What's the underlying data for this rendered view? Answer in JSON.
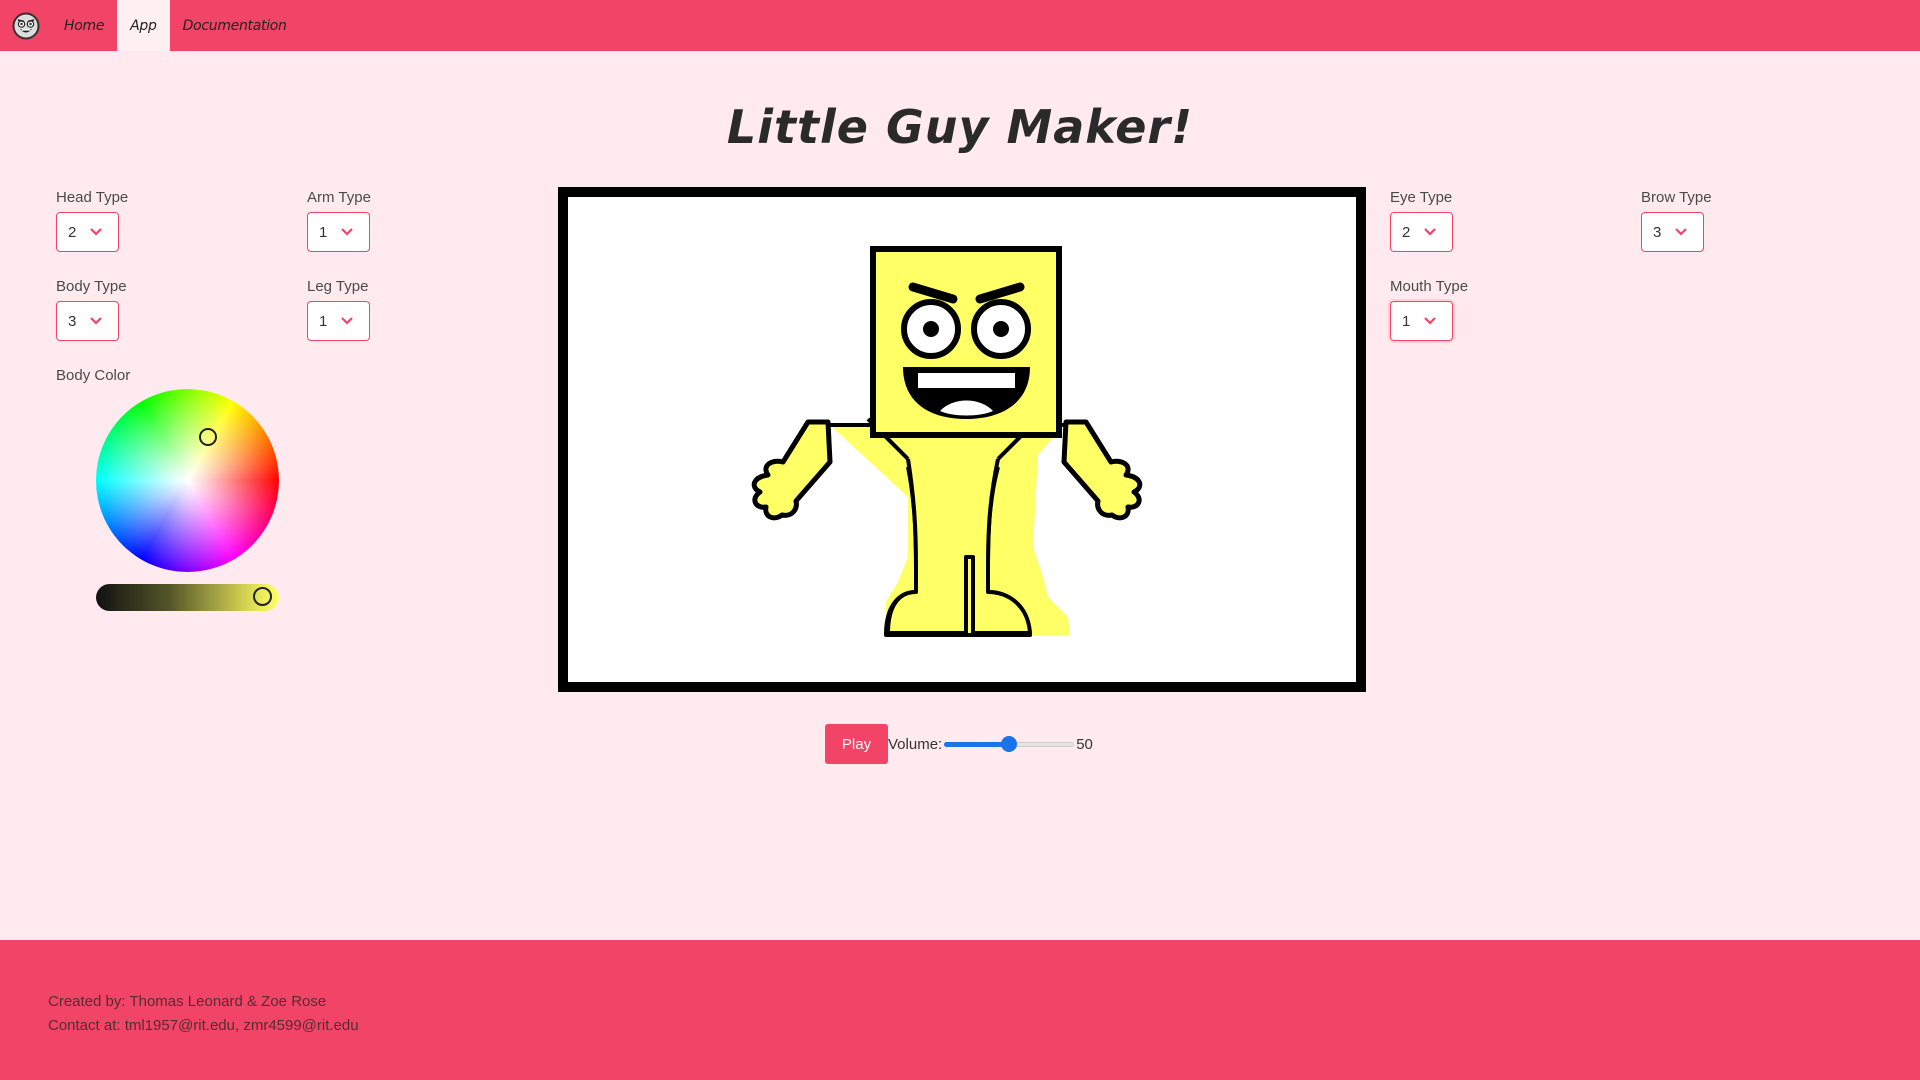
{
  "nav": {
    "items": [
      {
        "label": "Home",
        "active": false
      },
      {
        "label": "App",
        "active": true
      },
      {
        "label": "Documentation",
        "active": false
      }
    ]
  },
  "page": {
    "title": "Little Guy Maker!"
  },
  "controls": {
    "head_type": {
      "label": "Head Type",
      "value": "2"
    },
    "arm_type": {
      "label": "Arm Type",
      "value": "1"
    },
    "body_type": {
      "label": "Body Type",
      "value": "3"
    },
    "leg_type": {
      "label": "Leg Type",
      "value": "1"
    },
    "eye_type": {
      "label": "Eye Type",
      "value": "2"
    },
    "brow_type": {
      "label": "Brow Type",
      "value": "3"
    },
    "mouth_type": {
      "label": "Mouth Type",
      "value": "1"
    },
    "body_color": {
      "label": "Body Color",
      "value": "#ffff66"
    }
  },
  "player": {
    "play_label": "Play",
    "volume_label": "Volume:",
    "volume_value": "50",
    "volume_max": 100
  },
  "footer": {
    "created_by": "Created by: Thomas Leonard & Zoe Rose",
    "contact": "Contact at: tml1957@rit.edu, zmr4599@rit.edu"
  },
  "colors": {
    "accent": "#f24466",
    "background": "#ffebef",
    "slider": "#1a73e8"
  }
}
